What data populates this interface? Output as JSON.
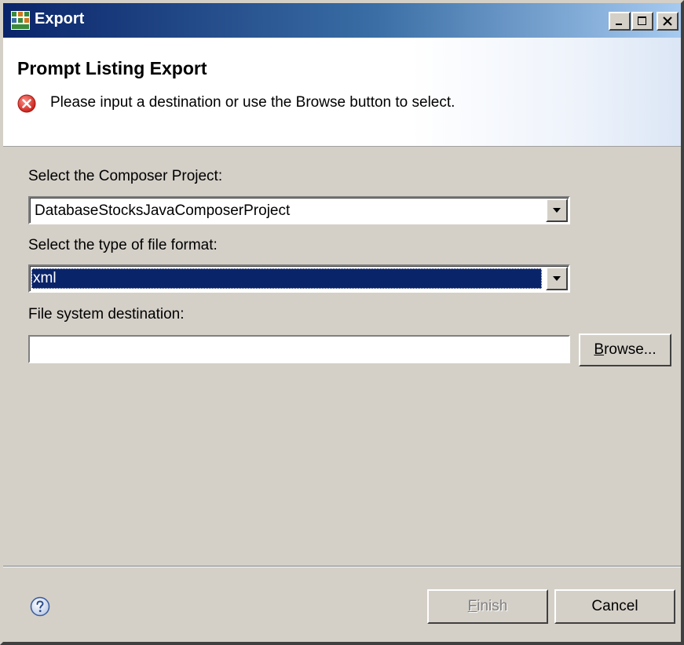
{
  "window": {
    "title": "Export",
    "controls": {
      "minimize": "_",
      "maximize": "□",
      "close": "×"
    }
  },
  "banner": {
    "title": "Prompt Listing Export",
    "message": "Please input a destination or use the Browse button to select.",
    "message_icon": "error-icon"
  },
  "form": {
    "project_label": "Select the Composer Project:",
    "project_value": "DatabaseStocksJavaComposerProject",
    "format_label": "Select the type of file format:",
    "format_value": "xml",
    "destination_label": "File system destination:",
    "destination_value": "",
    "browse_mnemonic": "B",
    "browse_rest": "rowse..."
  },
  "footer": {
    "help_icon": "help-icon",
    "finish_mnemonic": "F",
    "finish_rest": "inish",
    "cancel_label": "Cancel"
  },
  "colors": {
    "title_gradient_start": "#0a246a",
    "title_gradient_end": "#a6caf0",
    "selection": "#0a246a",
    "dialog_bg": "#d4d0c8",
    "error_red": "#d9302b"
  }
}
